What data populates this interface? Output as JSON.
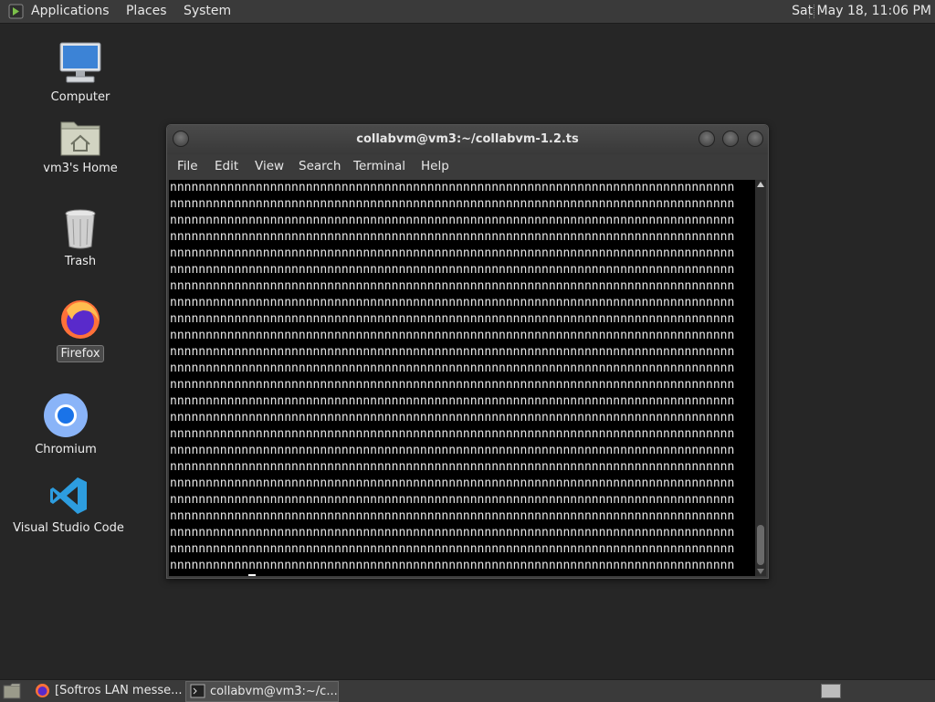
{
  "top_panel": {
    "menus": [
      "Applications",
      "Places",
      "System"
    ],
    "clock": "Sat May 18, 11:06 PM"
  },
  "desktop": {
    "icons": [
      {
        "label": "Computer",
        "icon": "computer-icon"
      },
      {
        "label": "vm3's Home",
        "icon": "home-folder-icon"
      },
      {
        "label": "Trash",
        "icon": "trash-icon"
      },
      {
        "label": "Firefox",
        "icon": "firefox-icon"
      },
      {
        "label": "Chromium",
        "icon": "chromium-icon"
      },
      {
        "label": "Visual Studio Code",
        "icon": "vscode-icon"
      }
    ]
  },
  "terminal": {
    "title": "collabvm@vm3:~/collabvm-1.2.ts",
    "menu": [
      "File",
      "Edit",
      "View",
      "Search",
      "Terminal",
      "Help"
    ],
    "lines": [
      "nnnnnnnnnnnnnnnnnnnnnnnnnnnnnnnnnnnnnnnnnnnnnnnnnnnnnnnnnnnnnnnnnnnnnnnnnnnnnnn",
      "nnnnnnnnnnnnnnnnnnnnnnnnnnnnnnnnnnnnnnnnnnnnnnnnnnnnnnnnnnnnnnnnnnnnnnnnnnnnnnn",
      "nnnnnnnnnnnnnnnnnnnnnnnnnnnnnnnnnnnnnnnnnnnnnnnnnnnnnnnnnnnnnnnnnnnnnnnnnnnnnnn",
      "nnnnnnnnnnnnnnnnnnnnnnnnnnnnnnnnnnnnnnnnnnnnnnnnnnnnnnnnnnnnnnnnnnnnnnnnnnnnnnn",
      "nnnnnnnnnnnnnnnnnnnnnnnnnnnnnnnnnnnnnnnnnnnnnnnnnnnnnnnnnnnnnnnnnnnnnnnnnnnnnnn",
      "nnnnnnnnnnnnnnnnnnnnnnnnnnnnnnnnnnnnnnnnnnnnnnnnnnnnnnnnnnnnnnnnnnnnnnnnnnnnnnn",
      "nnnnnnnnnnnnnnnnnnnnnnnnnnnnnnnnnnnnnnnnnnnnnnnnnnnnnnnnnnnnnnnnnnnnnnnnnnnnnnn",
      "nnnnnnnnnnnnnnnnnnnnnnnnnnnnnnnnnnnnnnnnnnnnnnnnnnnnnnnnnnnnnnnnnnnnnnnnnnnnnnn",
      "nnnnnnnnnnnnnnnnnnnnnnnnnnnnnnnnnnnnnnnnnnnnnnnnnnnnnnnnnnnnnnnnnnnnnnnnnnnnnnn",
      "nnnnnnnnnnnnnnnnnnnnnnnnnnnnnnnnnnnnnnnnnnnnnnnnnnnnnnnnnnnnnnnnnnnnnnnnnnnnnnn",
      "nnnnnnnnnnnnnnnnnnnnnnnnnnnnnnnnnnnnnnnnnnnnnnnnnnnnnnnnnnnnnnnnnnnnnnnnnnnnnnn",
      "nnnnnnnnnnnnnnnnnnnnnnnnnnnnnnnnnnnnnnnnnnnnnnnnnnnnnnnnnnnnnnnnnnnnnnnnnnnnnnn",
      "nnnnnnnnnnnnnnnnnnnnnnnnnnnnnnnnnnnnnnnnnnnnnnnnnnnnnnnnnnnnnnnnnnnnnnnnnnnnnnn",
      "nnnnnnnnnnnnnnnnnnnnnnnnnnnnnnnnnnnnnnnnnnnnnnnnnnnnnnnnnnnnnnnnnnnnnnnnnnnnnnn",
      "nnnnnnnnnnnnnnnnnnnnnnnnnnnnnnnnnnnnnnnnnnnnnnnnnnnnnnnnnnnnnnnnnnnnnnnnnnnnnnn",
      "nnnnnnnnnnnnnnnnnnnnnnnnnnnnnnnnnnnnnnnnnnnnnnnnnnnnnnnnnnnnnnnnnnnnnnnnnnnnnnn",
      "nnnnnnnnnnnnnnnnnnnnnnnnnnnnnnnnnnnnnnnnnnnnnnnnnnnnnnnnnnnnnnnnnnnnnnnnnnnnnnn",
      "nnnnnnnnnnnnnnnnnnnnnnnnnnnnnnnnnnnnnnnnnnnnnnnnnnnnnnnnnnnnnnnnnnnnnnnnnnnnnnn",
      "nnnnnnnnnnnnnnnnnnnnnnnnnnnnnnnnnnnnnnnnnnnnnnnnnnnnnnnnnnnnnnnnnnnnnnnnnnnnnnn",
      "nnnnnnnnnnnnnnnnnnnnnnnnnnnnnnnnnnnnnnnnnnnnnnnnnnnnnnnnnnnnnnnnnnnnnnnnnnnnnnn",
      "nnnnnnnnnnnnnnnnnnnnnnnnnnnnnnnnnnnnnnnnnnnnnnnnnnnnnnnnnnnnnnnnnnnnnnnnnnnnnnn",
      "nnnnnnnnnnnnnnnnnnnnnnnnnnnnnnnnnnnnnnnnnnnnnnnnnnnnnnnnnnnnnnnnnnnnnnnnnnnnnnn",
      "nnnnnnnnnnnnnnnnnnnnnnnnnnnnnnnnnnnnnnnnnnnnnnnnnnnnnnnnnnnnnnnnnnnnnnnnnnnnnnn",
      "nnnnnnnnnnnnnnnnnnnnnnnnnnnnnnnnnnnnnnnnnnnnnnnnnnnnnnnnnnnnnnnnnnnnnnnnnnnnnnn"
    ],
    "prompt_line": "nnnnnnnnnnn"
  },
  "taskbar": {
    "tasks": [
      {
        "label": "[Softros LAN messe...",
        "icon": "firefox-icon",
        "active": false
      },
      {
        "label": "collabvm@vm3:~/c...",
        "icon": "terminal-icon",
        "active": true
      }
    ]
  },
  "colors": {
    "desktop_bg": "#262626",
    "panel_bg": "#3a3a3a",
    "terminal_bg": "#000000",
    "terminal_fg": "#e6e6e6"
  }
}
